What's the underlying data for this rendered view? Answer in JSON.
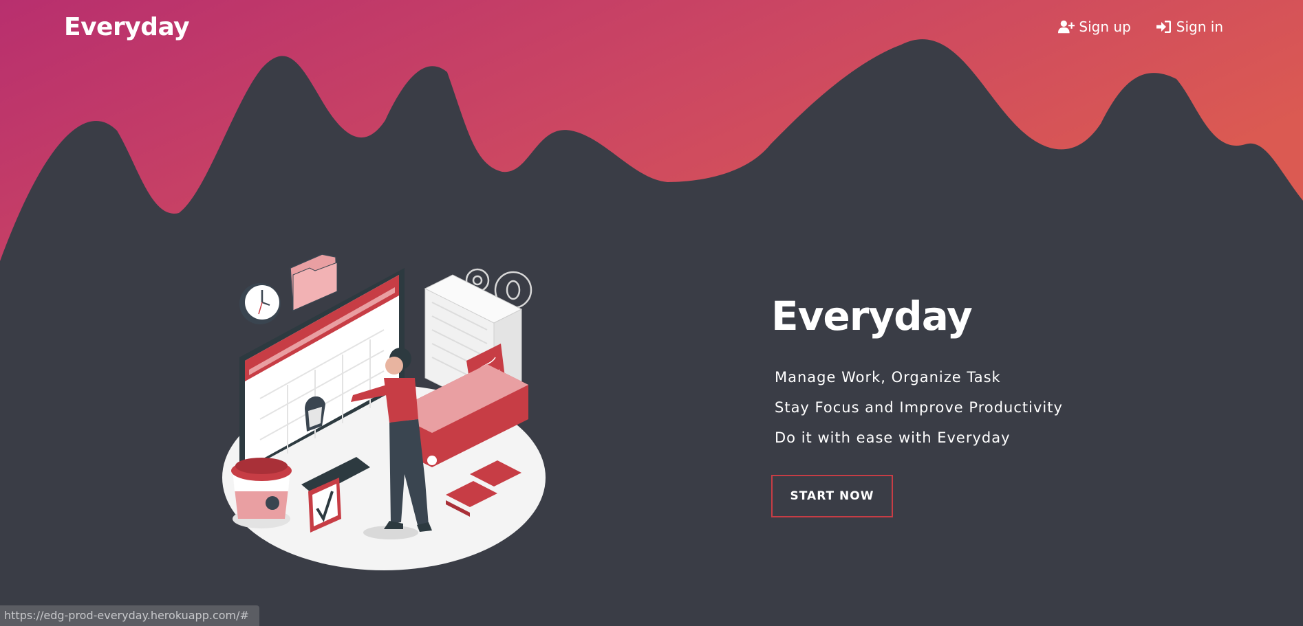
{
  "header": {
    "brand": "Everyday",
    "nav": {
      "signup_label": "Sign up",
      "signin_label": "Sign in"
    }
  },
  "hero": {
    "title": "Everyday",
    "taglines": [
      "Manage Work, Organize Task",
      "Stay Focus and Improve Productivity",
      "Do it with ease with Everyday"
    ],
    "cta_label": "START NOW"
  },
  "status_bar": {
    "url": "https://edg-prod-everyday.herokuapp.com/#"
  },
  "colors": {
    "background": "#3a3d46",
    "gradient_start": "#b82f6e",
    "gradient_end": "#db5a52",
    "accent": "#c73d45"
  },
  "icons": {
    "signup": "user-plus-icon",
    "signin": "sign-in-icon"
  }
}
